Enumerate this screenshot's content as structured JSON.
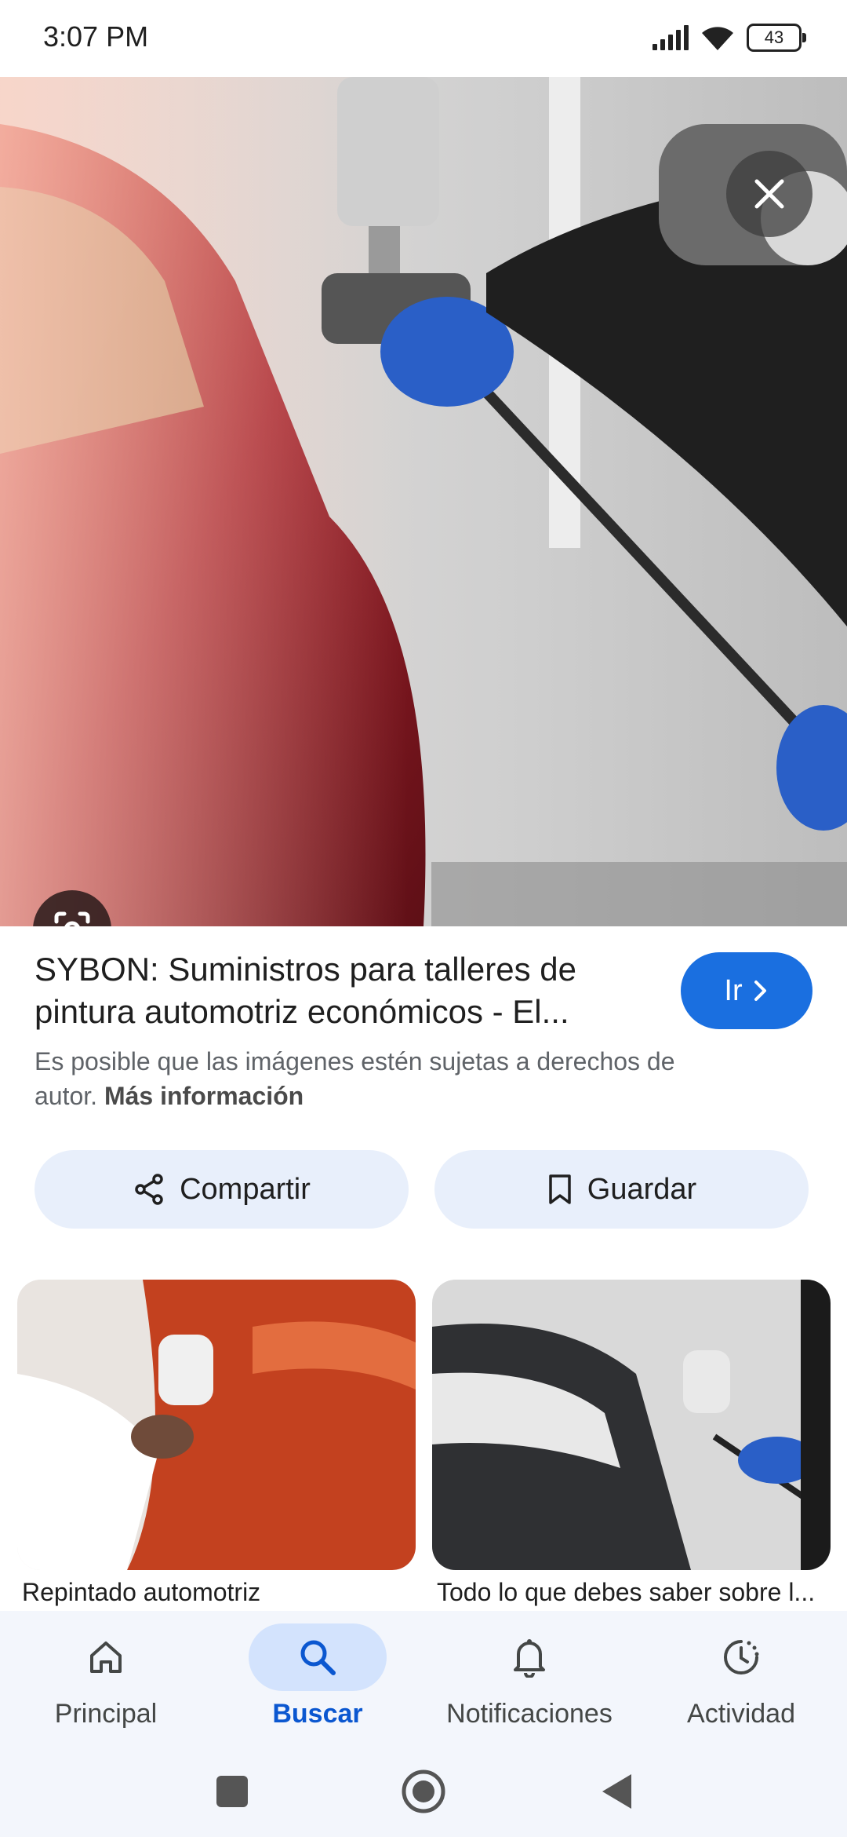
{
  "status_bar": {
    "time": "3:07 PM",
    "battery": "43"
  },
  "result": {
    "title": "SYBON: Suministros para talleres de pintura automotriz económicos - El...",
    "go_label": "Ir",
    "disclaimer": "Es posible que las imágenes estén sujetas a derechos de autor.",
    "more_info": "Más información"
  },
  "actions": {
    "share_label": "Compartir",
    "save_label": "Guardar"
  },
  "related": [
    {
      "caption": "Repintado automotriz"
    },
    {
      "caption": "Todo lo que debes saber sobre l..."
    }
  ],
  "bottom_nav": {
    "items": [
      {
        "label": "Principal",
        "icon": "home-icon"
      },
      {
        "label": "Buscar",
        "icon": "search-icon",
        "active": true
      },
      {
        "label": "Notificaciones",
        "icon": "bell-icon"
      },
      {
        "label": "Actividad",
        "icon": "activity-icon"
      }
    ]
  },
  "colors": {
    "accent": "#1a6fe0",
    "active_nav": "#0b57d0",
    "pill_bg": "#e8effb",
    "nav_bg": "#f3f6fc"
  }
}
